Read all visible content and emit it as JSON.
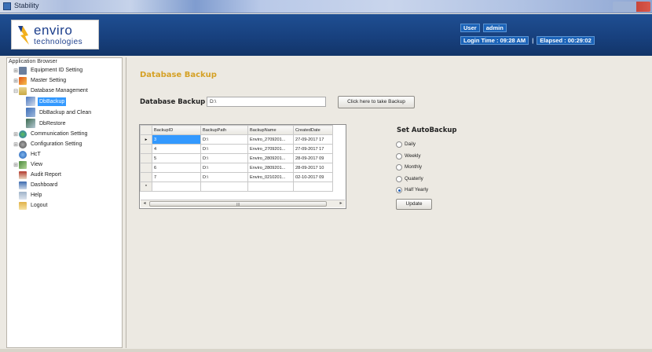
{
  "window": {
    "title": "Stability"
  },
  "logo": {
    "line1": "enviro",
    "line2": "technologies"
  },
  "header": {
    "user_label": "User",
    "user_value": "admin",
    "login_time": "Login Time : 09:28 AM",
    "separator": "|",
    "elapsed": "Elapsed : 00:29:02"
  },
  "sidebar": {
    "title": "Application Browser",
    "items": [
      {
        "label": "Equipment ID Setting",
        "icon": "equipment-icon"
      },
      {
        "label": "Master Setting",
        "icon": "master-setting-icon"
      },
      {
        "label": "Database Management",
        "icon": "database-icon"
      },
      {
        "label": "DbBackup",
        "icon": "db-backup-icon"
      },
      {
        "label": "DbBackup and Clean",
        "icon": "db-clean-icon"
      },
      {
        "label": "DbRestore",
        "icon": "db-restore-icon"
      },
      {
        "label": "Communication Setting",
        "icon": "communication-icon"
      },
      {
        "label": "Configuration Setting",
        "icon": "configuration-icon"
      },
      {
        "label": "HcT",
        "icon": "hct-icon"
      },
      {
        "label": "View",
        "icon": "view-icon"
      },
      {
        "label": "Audit Report",
        "icon": "audit-report-icon"
      },
      {
        "label": "Dashboard",
        "icon": "dashboard-icon"
      },
      {
        "label": "Help",
        "icon": "help-icon"
      },
      {
        "label": "Logout",
        "icon": "logout-icon"
      }
    ]
  },
  "main": {
    "page_title": "Database Backup",
    "db_label": "Database Backup",
    "db_path": "D:\\",
    "backup_button": "Click here to take Backup"
  },
  "grid": {
    "columns": [
      "BackupID",
      "BackupPath",
      "BackupName",
      "CreatedDate"
    ],
    "rows": [
      [
        "3",
        "D:\\",
        "Enviro_2709201...",
        "27-09-2017 17"
      ],
      [
        "4",
        "D:\\",
        "Enviro_2709201...",
        "27-09-2017 17"
      ],
      [
        "5",
        "D:\\",
        "Enviro_2809201...",
        "28-09-2017 09"
      ],
      [
        "6",
        "D:\\",
        "Enviro_2809201...",
        "28-09-2017 10"
      ],
      [
        "7",
        "D:\\",
        "Enviro_0210201...",
        "02-10-2017 09"
      ]
    ],
    "current_row_marker": "▸",
    "new_row_marker": "*",
    "scroll_grip": "III"
  },
  "autobackup": {
    "title": "Set AutoBackup",
    "options": [
      "Daily",
      "Weekly",
      "Monthly",
      "Quaterly",
      "Half Yearly"
    ],
    "selected": "Half Yearly",
    "update_button": "Update"
  },
  "colors": {
    "banner": "#1a4786",
    "page_title": "#d5a126",
    "selection": "#3399ff"
  }
}
